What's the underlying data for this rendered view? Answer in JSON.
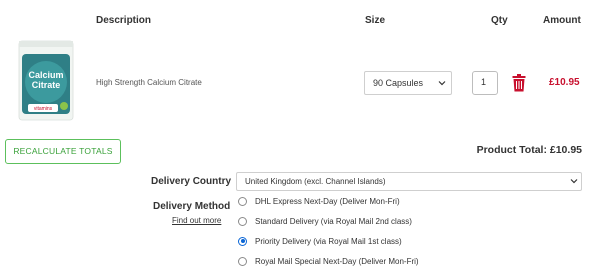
{
  "headers": {
    "description": "Description",
    "size": "Size",
    "qty": "Qty",
    "amount": "Amount"
  },
  "product": {
    "image_text": {
      "line1": "Calcium",
      "line2": "Citrate",
      "brand": "vitamins"
    },
    "name": "High Strength Calcium Citrate",
    "size": "90 Capsules",
    "qty": "1",
    "amount": "£10.95"
  },
  "actions": {
    "recalculate": "RECALCULATE TOTALS"
  },
  "totals": {
    "product_total": "Product Total: £10.95"
  },
  "delivery": {
    "country_label": "Delivery Country",
    "country_value": "United Kingdom (excl. Channel Islands)",
    "method_label": "Delivery Method",
    "find_out_more": "Find out more",
    "options": [
      {
        "label": "DHL Express Next-Day (Deliver Mon-Fri)",
        "selected": false
      },
      {
        "label": "Standard Delivery (via Royal Mail 2nd class)",
        "selected": false
      },
      {
        "label": "Priority Delivery (via Royal Mail 1st class)",
        "selected": true
      },
      {
        "label": "Royal Mail Special Next-Day (Deliver Mon-Fri)",
        "selected": false
      }
    ]
  },
  "colors": {
    "price_red": "#c8102e",
    "button_green": "#3aa13a",
    "radio_blue": "#0a66d6"
  },
  "icons": {
    "delete": "trash-icon",
    "dropdown": "chevron-down-icon"
  }
}
